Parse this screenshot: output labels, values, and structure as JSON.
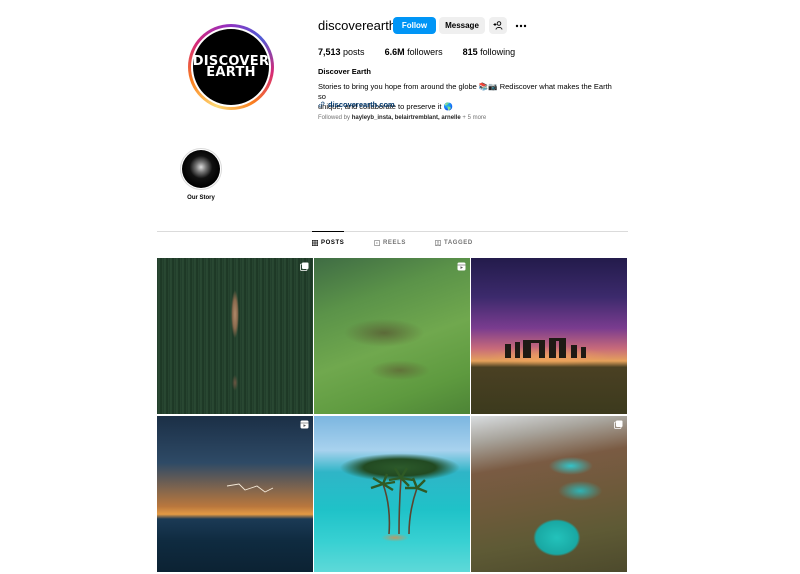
{
  "profile": {
    "username": "discoverearth",
    "avatar_text_line1": "DISCOVER",
    "avatar_text_line2": "EARTH",
    "follow_label": "Follow",
    "message_label": "Message",
    "suggest_icon": "person-add-icon",
    "more_icon": "more-horizontal-icon",
    "posts_count": "7,513",
    "posts_label": "posts",
    "followers_count": "6.6M",
    "followers_label": "followers",
    "following_count": "815",
    "following_label": "following",
    "full_name": "Discover Earth",
    "bio_line1": "Stories to bring you hope from around the globe 📚📷 Rediscover what makes the Earth so",
    "bio_line2": "unique, and collaborate to preserve it 🌎",
    "link_text": "discoverearth.com",
    "followed_by_prefix": "Followed by",
    "followed_by_names": "hayleyb_insta, belairtremblant, arnelle",
    "followed_by_more": "+ 5 more"
  },
  "highlights": [
    {
      "label": "Our Story"
    }
  ],
  "tabs": [
    {
      "label": "POSTS",
      "icon": "grid-icon",
      "active": true
    },
    {
      "label": "REELS",
      "icon": "reels-icon",
      "active": false
    },
    {
      "label": "TAGGED",
      "icon": "tagged-icon",
      "active": false
    }
  ],
  "posts": [
    {
      "subject": "aerial deer in green field",
      "badge_icon": "carousel-icon"
    },
    {
      "subject": "herd of animals on green hillside",
      "badge_icon": "reel-icon"
    },
    {
      "subject": "stonehenge under aurora",
      "badge_icon": ""
    },
    {
      "subject": "lightning storm over ocean at sunset",
      "badge_icon": "reel-icon"
    },
    {
      "subject": "palm trees on islet in turquoise lagoon",
      "badge_icon": ""
    },
    {
      "subject": "turquoise mountain lakes",
      "badge_icon": "carousel-icon"
    }
  ],
  "colors": {
    "follow_button": "#0095f6",
    "secondary_button": "#efefef",
    "link": "#00376b",
    "muted_text": "#737373",
    "divider": "#dbdbdb"
  }
}
